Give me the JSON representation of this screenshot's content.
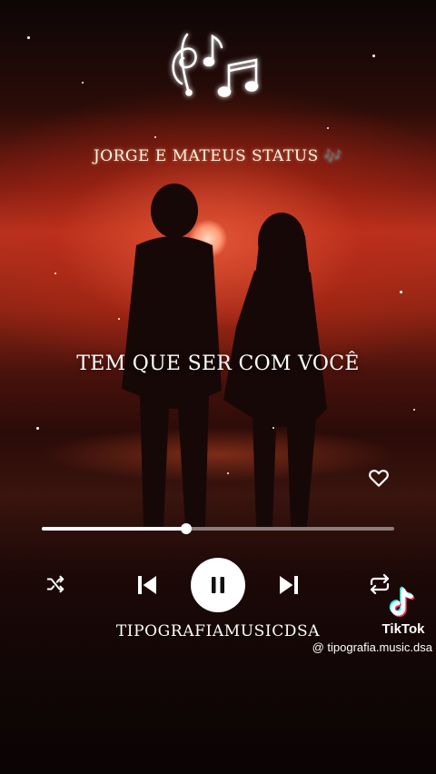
{
  "video": {
    "header_title": "JORGE E MATEUS STATUS",
    "header_emoji": "🎶",
    "lyric": "TEM QUE SER COM VOCÊ",
    "brand": "TIPOGRAFIAMUSICDSA"
  },
  "player": {
    "progress_fraction": 0.41,
    "controls": [
      "shuffle-icon",
      "previous-icon",
      "pause-icon",
      "next-icon",
      "repeat-icon"
    ],
    "like_icon": "heart-icon"
  },
  "tiktok": {
    "name": "TikTok",
    "handle": "@ tipografia.music.dsa"
  },
  "colors": {
    "accent_white": "#ffffff",
    "sunset_red": "#b93420",
    "tiktok_cyan": "#25f4ee",
    "tiktok_pink": "#fe2c55"
  }
}
